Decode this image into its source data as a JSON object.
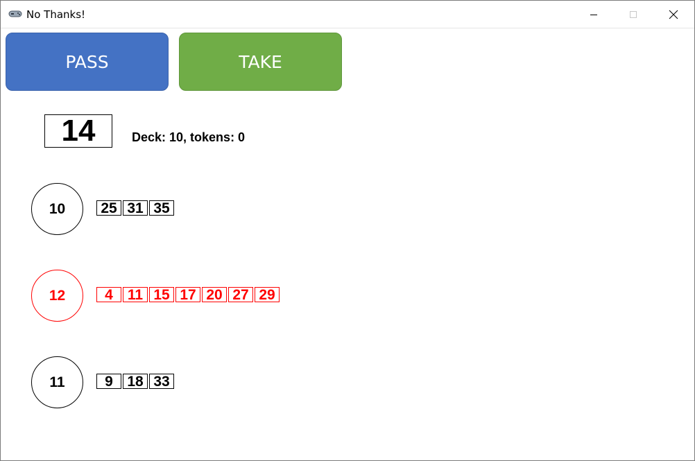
{
  "window": {
    "title": "No Thanks!"
  },
  "controls": {
    "pass_label": "PASS",
    "take_label": "TAKE"
  },
  "current_card": {
    "value": "14"
  },
  "status": {
    "text": "Deck: 10, tokens: 0"
  },
  "players": [
    {
      "tokens": "10",
      "cards": [
        "25",
        "31",
        "35"
      ],
      "active": false
    },
    {
      "tokens": "12",
      "cards": [
        "4",
        "11",
        "15",
        "17",
        "20",
        "27",
        "29"
      ],
      "active": true
    },
    {
      "tokens": "11",
      "cards": [
        "9",
        "18",
        "33"
      ],
      "active": false
    }
  ],
  "colors": {
    "pass": "#4472c4",
    "take": "#70ad47",
    "active_player": "#ff0000"
  },
  "icons": {
    "app": "gamepad-icon",
    "minimize": "minimize-icon",
    "maximize": "maximize-icon",
    "close": "close-icon"
  }
}
